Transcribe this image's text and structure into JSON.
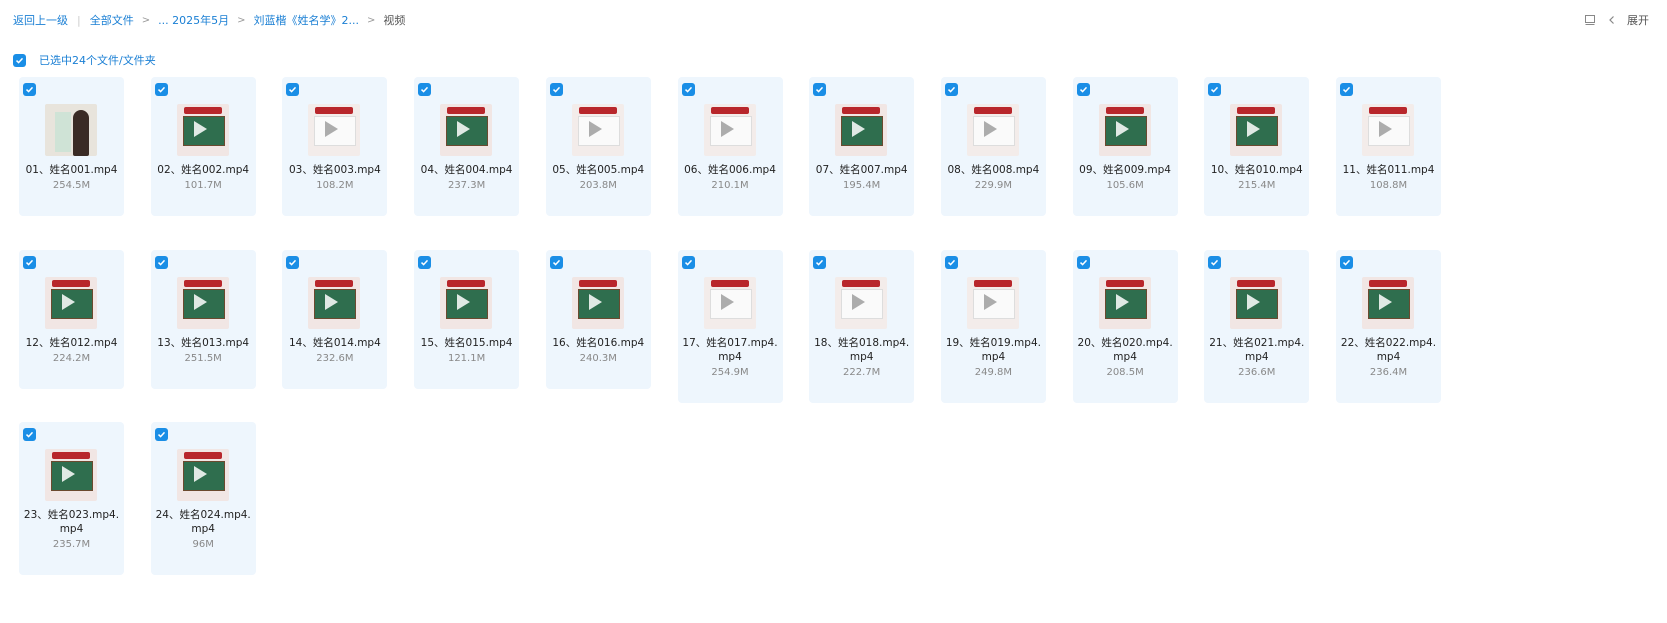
{
  "breadcrumb": {
    "back": "返回上一级",
    "all": "全部文件",
    "level1": "... 2025年5月",
    "level2": "刘蓝楷《姓名学》2...",
    "current": "视频"
  },
  "toolbar": {
    "expand_label": "展开"
  },
  "selection": {
    "text": "已选中24个文件/文件夹"
  },
  "files": [
    {
      "name": "01、姓名001.mp4",
      "size": "254.5M",
      "thumb": "person"
    },
    {
      "name": "02、姓名002.mp4",
      "size": "101.7M",
      "thumb": "board"
    },
    {
      "name": "03、姓名003.mp4",
      "size": "108.2M",
      "thumb": "sheet"
    },
    {
      "name": "04、姓名004.mp4",
      "size": "237.3M",
      "thumb": "board"
    },
    {
      "name": "05、姓名005.mp4",
      "size": "203.8M",
      "thumb": "sheet"
    },
    {
      "name": "06、姓名006.mp4",
      "size": "210.1M",
      "thumb": "sheet"
    },
    {
      "name": "07、姓名007.mp4",
      "size": "195.4M",
      "thumb": "board"
    },
    {
      "name": "08、姓名008.mp4",
      "size": "229.9M",
      "thumb": "sheet"
    },
    {
      "name": "09、姓名009.mp4",
      "size": "105.6M",
      "thumb": "board"
    },
    {
      "name": "10、姓名010.mp4",
      "size": "215.4M",
      "thumb": "board"
    },
    {
      "name": "11、姓名011.mp4",
      "size": "108.8M",
      "thumb": "sheet"
    },
    {
      "name": "12、姓名012.mp4",
      "size": "224.2M",
      "thumb": "board"
    },
    {
      "name": "13、姓名013.mp4",
      "size": "251.5M",
      "thumb": "board"
    },
    {
      "name": "14、姓名014.mp4",
      "size": "232.6M",
      "thumb": "board"
    },
    {
      "name": "15、姓名015.mp4",
      "size": "121.1M",
      "thumb": "board"
    },
    {
      "name": "16、姓名016.mp4",
      "size": "240.3M",
      "thumb": "board"
    },
    {
      "name": "17、姓名017.mp4.mp4",
      "size": "254.9M",
      "thumb": "sheet"
    },
    {
      "name": "18、姓名018.mp4.mp4",
      "size": "222.7M",
      "thumb": "sheet"
    },
    {
      "name": "19、姓名019.mp4.mp4",
      "size": "249.8M",
      "thumb": "sheet"
    },
    {
      "name": "20、姓名020.mp4.mp4",
      "size": "208.5M",
      "thumb": "board"
    },
    {
      "name": "21、姓名021.mp4.mp4",
      "size": "236.6M",
      "thumb": "board"
    },
    {
      "name": "22、姓名022.mp4.mp4",
      "size": "236.4M",
      "thumb": "board"
    },
    {
      "name": "23、姓名023.mp4.mp4",
      "size": "235.7M",
      "thumb": "board"
    },
    {
      "name": "24、姓名024.mp4.mp4",
      "size": "96M",
      "thumb": "board"
    }
  ]
}
